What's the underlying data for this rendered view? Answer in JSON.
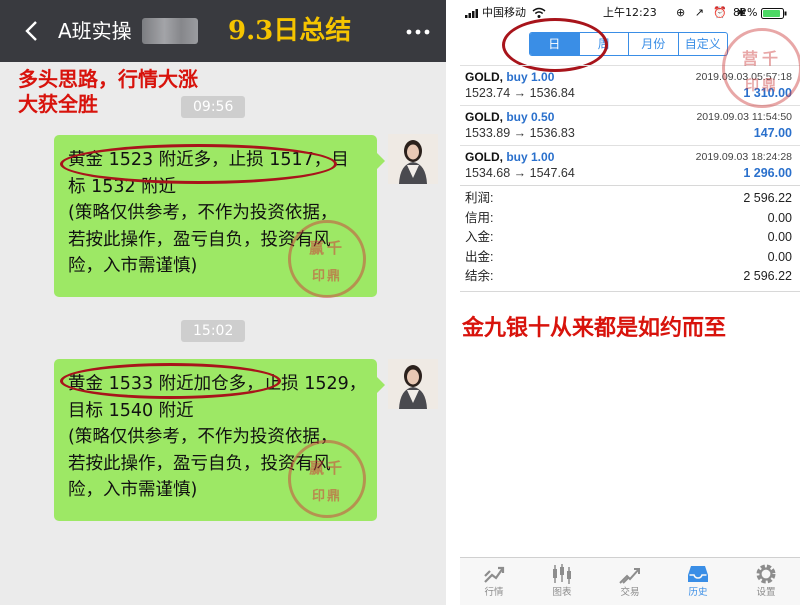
{
  "chat": {
    "title": "A班实操",
    "summary_title": "9.3日总结",
    "strategy_note": [
      "多头思路，行情大涨",
      "大获全胜"
    ],
    "messages": [
      {
        "time": "09:56",
        "lines": [
          "黄金 1523 附近多，止损 1517，目",
          "标 1532 附近",
          "(策略仅供参考，不作为投资依据，",
          "若按此操作，盈亏自负，投资有风",
          "险，入市需谨慎)"
        ]
      },
      {
        "time": "15:02",
        "lines": [
          "黄金 1533 附近加仓多，止损 1529，",
          "目标 1540 附近",
          "(策略仅供参考，不作为投资依据，",
          "若按此操作，盈亏自负，投资有风",
          "险，入市需谨慎)"
        ]
      }
    ]
  },
  "stamps": {
    "chat": [
      "赢千",
      "印鼎"
    ],
    "trade": [
      "营千",
      "印鼎"
    ]
  },
  "status_bar": {
    "carrier": "中国移动",
    "time": "上午12:23",
    "icons": "⊕ ↗ ⏰ ✱",
    "battery": "82%"
  },
  "period_tabs": [
    {
      "label": "日",
      "active": true
    },
    {
      "label": "周",
      "active": false
    },
    {
      "label": "月份",
      "active": false
    },
    {
      "label": "自定义",
      "active": false
    }
  ],
  "deals": [
    {
      "symbol": "GOLD,",
      "action": "buy 1.00",
      "time": "2019.09.03 05:57:18",
      "prices": "1523.74 → 1536.84",
      "profit": "1 310.00"
    },
    {
      "symbol": "GOLD,",
      "action": "buy 0.50",
      "time": "2019.09.03 11:54:50",
      "prices": "1533.89 → 1536.83",
      "profit": "147.00"
    },
    {
      "symbol": "GOLD,",
      "action": "buy 1.00",
      "time": "2019.09.03 18:24:28",
      "prices": "1534.68 → 1547.64",
      "profit": "1 296.00"
    }
  ],
  "summary": [
    {
      "label": "利润:",
      "value": "2 596.22"
    },
    {
      "label": "信用:",
      "value": "0.00"
    },
    {
      "label": "入金:",
      "value": "0.00"
    },
    {
      "label": "出金:",
      "value": "0.00"
    },
    {
      "label": "结余:",
      "value": "2 596.22"
    }
  ],
  "promo": "金九银十从来都是如约而至",
  "bottom_nav": [
    {
      "label": "行情",
      "icon": "quotes-icon",
      "active": false
    },
    {
      "label": "图表",
      "icon": "chart-icon",
      "active": false
    },
    {
      "label": "交易",
      "icon": "trade-icon",
      "active": false
    },
    {
      "label": "历史",
      "icon": "history-icon",
      "active": true
    },
    {
      "label": "设置",
      "icon": "gear-icon",
      "active": false
    }
  ],
  "colors": {
    "accent_blue": "#3a8ee6",
    "bubble_green": "#9de865",
    "headline_red": "#d8130c",
    "title_gold": "#f5c400"
  }
}
